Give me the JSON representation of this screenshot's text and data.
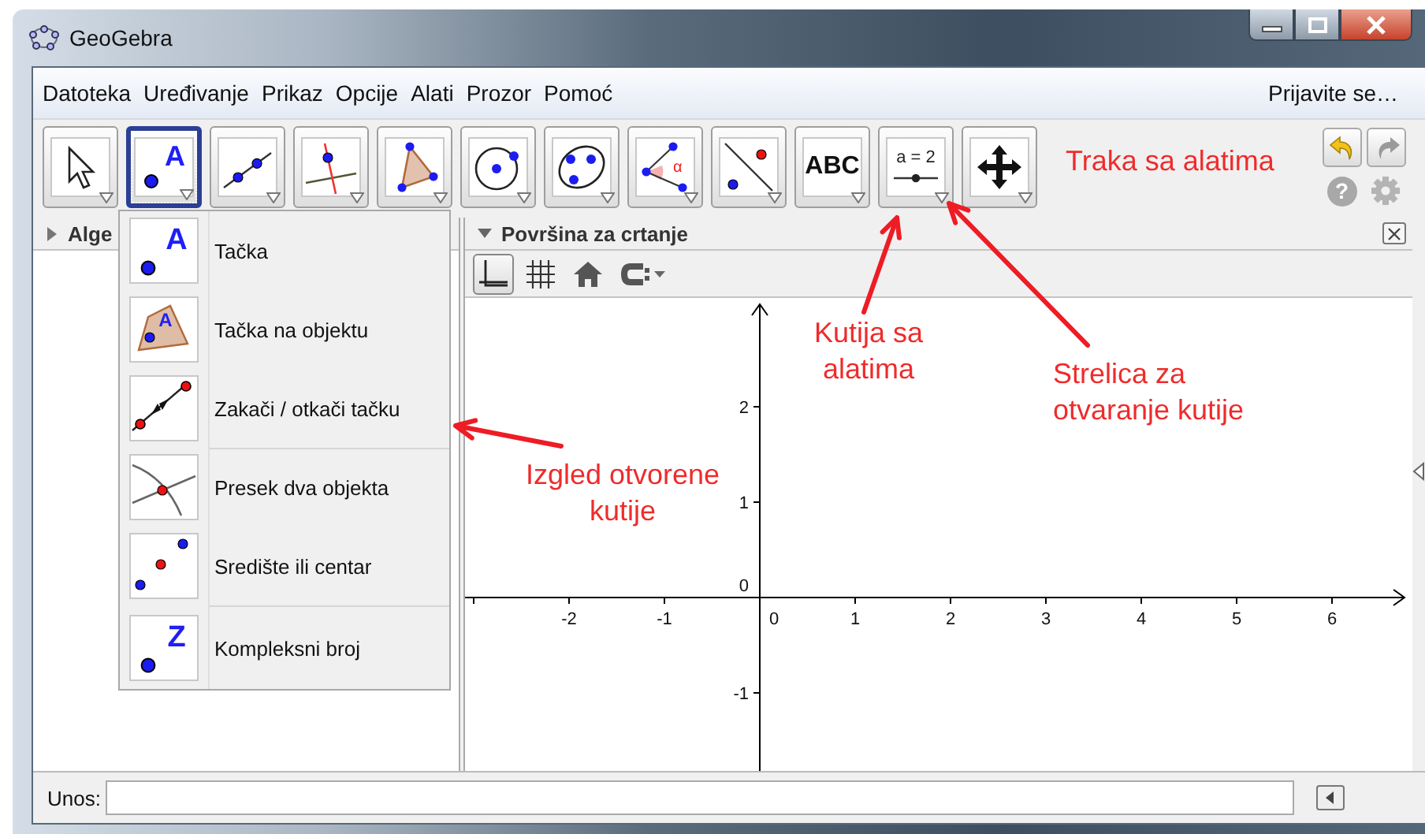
{
  "window": {
    "title": "GeoGebra"
  },
  "menu": [
    "Datoteka",
    "Uređivanje",
    "Prikaz",
    "Opcije",
    "Alati",
    "Prozor",
    "Pomoć"
  ],
  "sign_in": "Prijavite se…",
  "tools": [
    {
      "kind": "move",
      "selected": false
    },
    {
      "kind": "point",
      "glyph": "A",
      "selected": true
    },
    {
      "kind": "line",
      "selected": false
    },
    {
      "kind": "perpendicular",
      "selected": false
    },
    {
      "kind": "polygon",
      "selected": false
    },
    {
      "kind": "circle",
      "selected": false
    },
    {
      "kind": "conic",
      "selected": false
    },
    {
      "kind": "angle",
      "glyph": "α",
      "selected": false
    },
    {
      "kind": "reflect",
      "selected": false
    },
    {
      "kind": "text",
      "glyph": "ABC",
      "selected": false
    },
    {
      "kind": "slider",
      "glyph": "a = 2",
      "selected": false
    },
    {
      "kind": "move_view",
      "selected": false
    }
  ],
  "help_glyph": "?",
  "algebra_panel": {
    "title": "Alge"
  },
  "graphics_panel": {
    "title": "Površina za crtanje",
    "style_bar": [
      {
        "kind": "axes",
        "on": true
      },
      {
        "kind": "grid",
        "on": false
      },
      {
        "kind": "home"
      },
      {
        "kind": "point_capture"
      }
    ],
    "x_labels": [
      "-2",
      "-1",
      "0",
      "1",
      "2",
      "3",
      "4",
      "5",
      "6"
    ],
    "y_labels": [
      "2",
      "1",
      "0",
      "-1"
    ]
  },
  "tool_menu": {
    "groups": [
      [
        {
          "kind": "point",
          "glyph": "A",
          "label": "Tačka"
        },
        {
          "kind": "point_on_object",
          "glyph": "A",
          "label": "Tačka na objektu"
        },
        {
          "kind": "attach",
          "label": "Zakači / otkači tačku"
        }
      ],
      [
        {
          "kind": "intersect",
          "label": "Presek dva objekta"
        },
        {
          "kind": "midpoint",
          "label": "Središte ili centar"
        }
      ],
      [
        {
          "kind": "point",
          "glyph": "Z",
          "label": "Kompleksni broj"
        }
      ]
    ]
  },
  "input_bar": {
    "label": "Unos:"
  },
  "annotations": [
    "Traka sa alatima",
    "Kutija sa alatima",
    "Strelica za otvaranje kutije",
    "Izgled otvorene kutije"
  ]
}
